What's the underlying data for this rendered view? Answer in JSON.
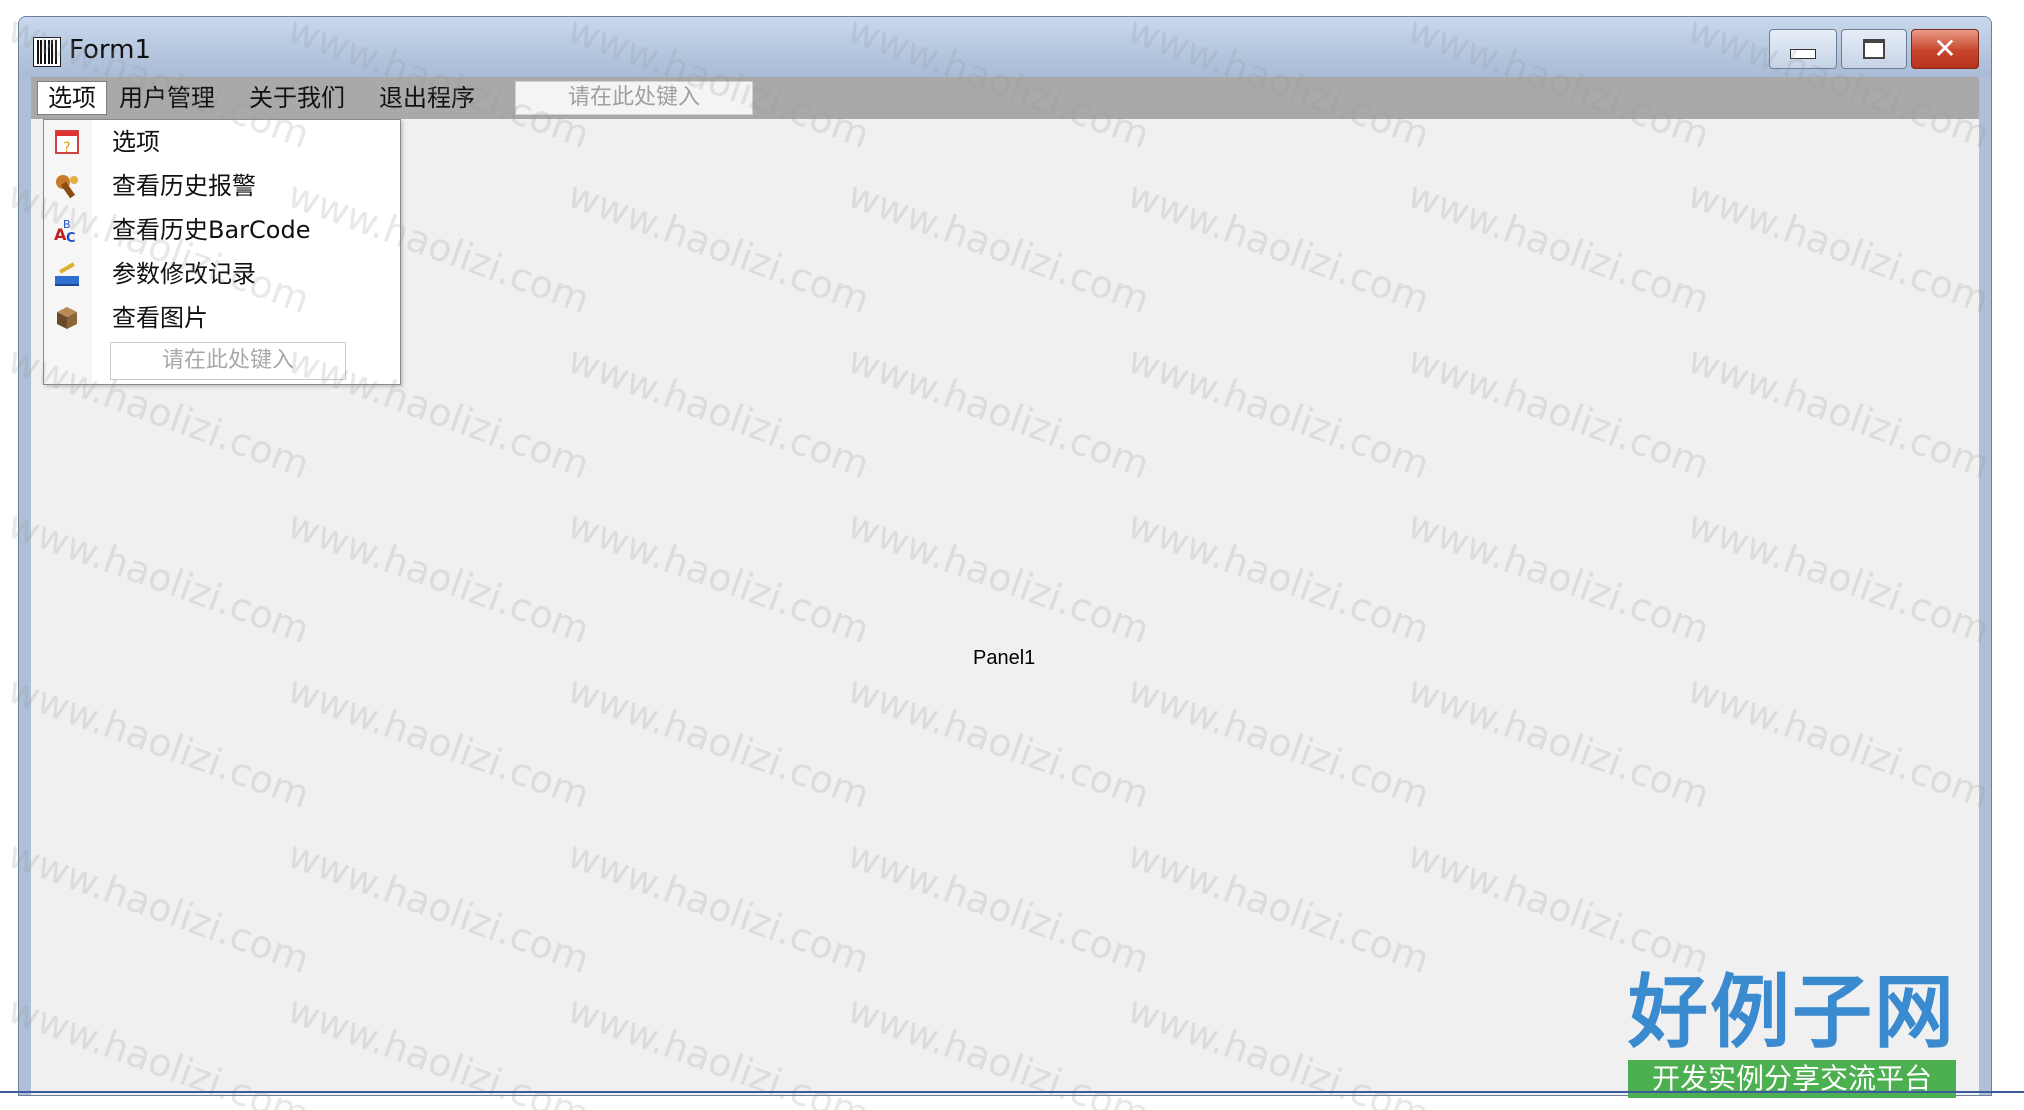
{
  "window": {
    "title": "Form1",
    "icon": "barcode-icon",
    "controls": [
      "minimize-icon",
      "maximize-icon",
      "close-icon"
    ]
  },
  "menubar": {
    "items": [
      {
        "label": "选项"
      },
      {
        "label": "用户管理"
      },
      {
        "label": "关于我们"
      },
      {
        "label": "退出程序"
      }
    ],
    "type_here": "请在此处键入"
  },
  "dropdown": {
    "items": [
      {
        "label": "选项",
        "icon": "options-icon"
      },
      {
        "label": "查看历史报警",
        "icon": "alarm-history-icon"
      },
      {
        "label": "查看历史BarCode",
        "icon": "barcode-history-icon"
      },
      {
        "label": "参数修改记录",
        "icon": "edit-log-icon"
      },
      {
        "label": "查看图片",
        "icon": "picture-icon"
      }
    ],
    "type_here": "请在此处键入"
  },
  "panel": {
    "label": "Panel1"
  },
  "watermark": {
    "text": "www.haolizi.com"
  },
  "brand": {
    "title": "好例子网",
    "subtitle": "开发实例分享交流平台"
  },
  "colors": {
    "menubar": "#a9a9a9",
    "client": "#f0f0f0",
    "brand_blue": "#3a8ad0",
    "brand_green": "#4caf50"
  }
}
